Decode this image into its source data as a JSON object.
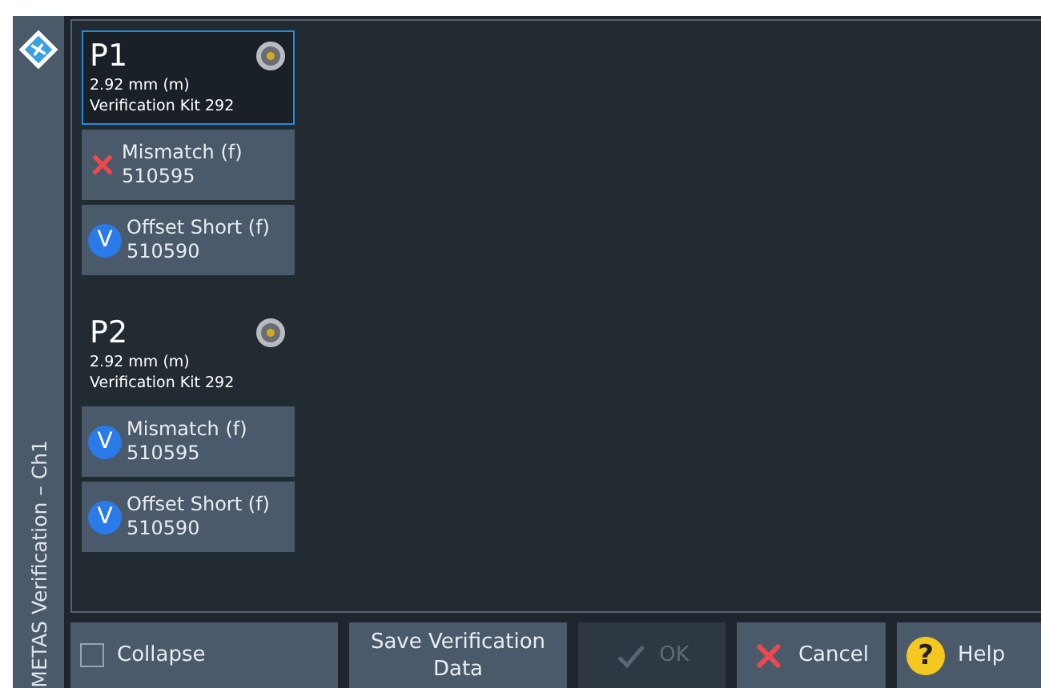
{
  "sidebar": {
    "title": "METAS Verification – Ch1"
  },
  "ports": [
    {
      "label": "P1",
      "connector": "2.92 mm (m)",
      "kit": "Verification Kit 292",
      "selected": true,
      "standards": [
        {
          "name": "Mismatch (f)",
          "serial": "510595",
          "kind": "failed"
        },
        {
          "name": "Offset Short (f)",
          "serial": "510590",
          "kind": "verified",
          "mark": "V"
        }
      ]
    },
    {
      "label": "P2",
      "connector": "2.92 mm (m)",
      "kit": "Verification Kit 292",
      "selected": false,
      "standards": [
        {
          "name": "Mismatch (f)",
          "serial": "510595",
          "kind": "verified",
          "mark": "V"
        },
        {
          "name": "Offset Short (f)",
          "serial": "510590",
          "kind": "verified",
          "mark": "V"
        }
      ]
    }
  ],
  "collapse": {
    "label": "Collapse",
    "checked": false
  },
  "buttons": [
    {
      "kind": "save",
      "label": "Save Verification Data",
      "disabled": false
    },
    {
      "kind": "ok",
      "label": "OK",
      "disabled": true
    },
    {
      "kind": "cancel",
      "label": "Cancel",
      "disabled": false
    },
    {
      "kind": "help",
      "label": "Help",
      "icon": "?",
      "disabled": false
    }
  ]
}
